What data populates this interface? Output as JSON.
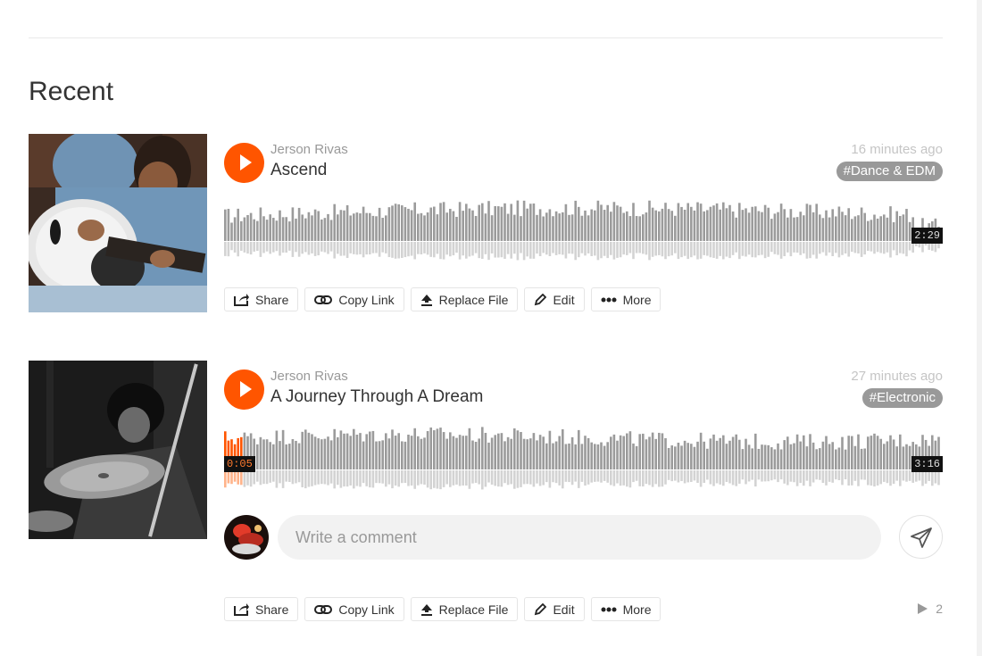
{
  "section": {
    "title": "Recent"
  },
  "colors": {
    "accent": "#ff5500",
    "tag_bg": "#999999",
    "wave_top": "#9b9b9b",
    "wave_bottom": "#d3d3d3"
  },
  "tracks": [
    {
      "artist": "Jerson Rivas",
      "title": "Ascend",
      "time_ago": "16 minutes ago",
      "genre": "#Dance & EDM",
      "duration": "2:29",
      "progress": 0
    },
    {
      "artist": "Jerson Rivas",
      "title": "A Journey Through A Dream",
      "time_ago": "27 minutes ago",
      "genre": "#Electronic",
      "duration": "3:16",
      "elapsed": "0:05",
      "progress": 0.026,
      "play_count": "2"
    }
  ],
  "comment": {
    "placeholder": "Write a comment"
  },
  "actions": {
    "share": "Share",
    "copy_link": "Copy Link",
    "replace_file": "Replace File",
    "edit": "Edit",
    "more": "More"
  },
  "icons": {
    "share": "share-icon",
    "copy_link": "link-icon",
    "replace_file": "upload-icon",
    "edit": "pencil-icon",
    "more": "ellipsis-icon",
    "play": "play-icon",
    "send": "send-icon"
  }
}
